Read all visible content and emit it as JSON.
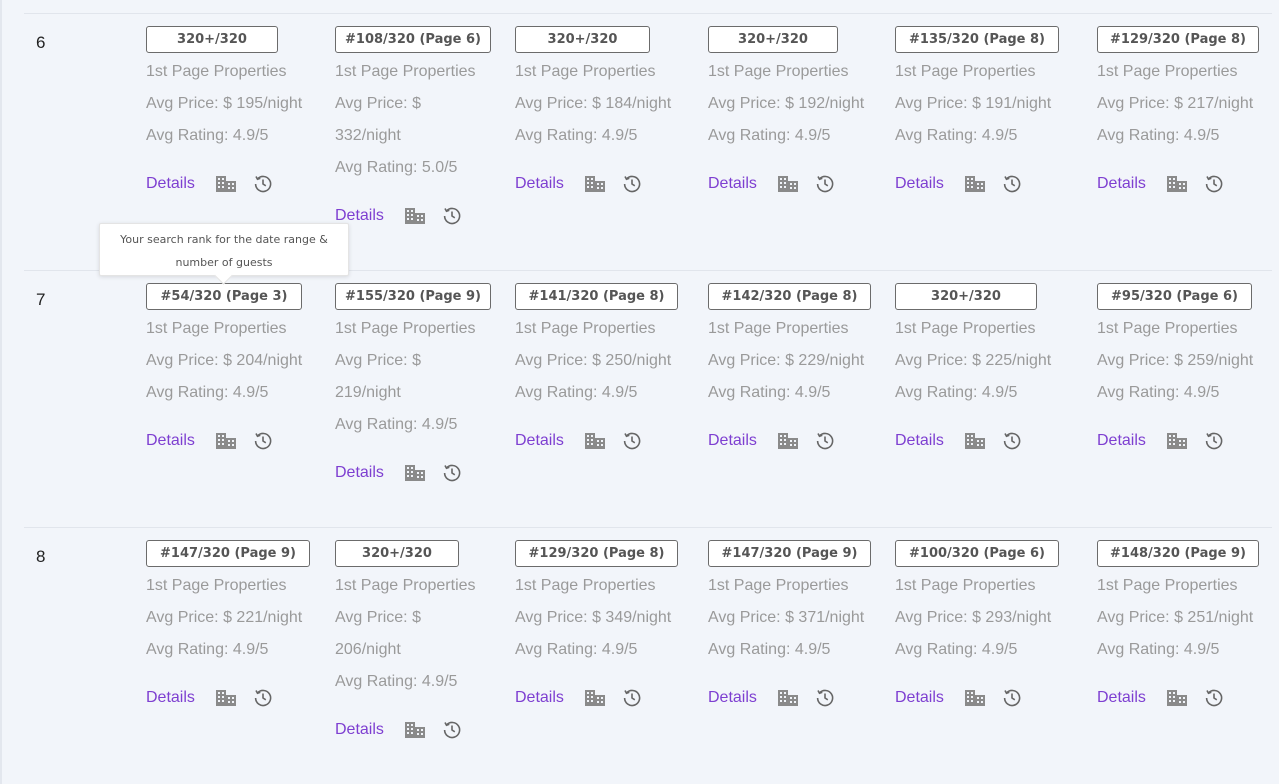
{
  "rows": [
    {
      "label": "6",
      "cells": [
        {
          "rank": "320+/320",
          "line1": "1st Page Properties",
          "price": "Avg Price: $ 195/night",
          "rating": "Avg Rating: 4.9/5",
          "details": "Details"
        },
        {
          "rank": "#108/320 (Page 6)",
          "line1": "1st Page Properties",
          "price": "Avg Price: $ 332/night",
          "rating": "Avg Rating: 5.0/5",
          "details": "Details"
        },
        {
          "rank": "320+/320",
          "line1": "1st Page Properties",
          "price": "Avg Price: $ 184/night",
          "rating": "Avg Rating: 4.9/5",
          "details": "Details"
        },
        {
          "rank": "320+/320",
          "line1": "1st Page Properties",
          "price": "Avg Price: $ 192/night",
          "rating": "Avg Rating: 4.9/5",
          "details": "Details"
        },
        {
          "rank": "#135/320 (Page 8)",
          "line1": "1st Page Properties",
          "price": "Avg Price: $ 191/night",
          "rating": "Avg Rating: 4.9/5",
          "details": "Details"
        },
        {
          "rank": "#129/320 (Page 8)",
          "line1": "1st Page Properties",
          "price": "Avg Price: $ 217/night",
          "rating": "Avg Rating: 4.9/5",
          "details": "Details"
        }
      ]
    },
    {
      "label": "7",
      "cells": [
        {
          "rank": "#54/320 (Page 3)",
          "line1": "1st Page Properties",
          "price": "Avg Price: $ 204/night",
          "rating": "Avg Rating: 4.9/5",
          "details": "Details"
        },
        {
          "rank": "#155/320 (Page 9)",
          "line1": "1st Page Properties",
          "price": "Avg Price: $ 219/night",
          "rating": "Avg Rating: 4.9/5",
          "details": "Details"
        },
        {
          "rank": "#141/320 (Page 8)",
          "line1": "1st Page Properties",
          "price": "Avg Price: $ 250/night",
          "rating": "Avg Rating: 4.9/5",
          "details": "Details"
        },
        {
          "rank": "#142/320 (Page 8)",
          "line1": "1st Page Properties",
          "price": "Avg Price: $ 229/night",
          "rating": "Avg Rating: 4.9/5",
          "details": "Details"
        },
        {
          "rank": "320+/320",
          "line1": "1st Page Properties",
          "price": "Avg Price: $ 225/night",
          "rating": "Avg Rating: 4.9/5",
          "details": "Details"
        },
        {
          "rank": "#95/320 (Page 6)",
          "line1": "1st Page Properties",
          "price": "Avg Price: $ 259/night",
          "rating": "Avg Rating: 4.9/5",
          "details": "Details"
        }
      ]
    },
    {
      "label": "8",
      "cells": [
        {
          "rank": "#147/320 (Page 9)",
          "line1": "1st Page Properties",
          "price": "Avg Price: $ 221/night",
          "rating": "Avg Rating: 4.9/5",
          "details": "Details"
        },
        {
          "rank": "320+/320",
          "line1": "1st Page Properties",
          "price": "Avg Price: $ 206/night",
          "rating": "Avg Rating: 4.9/5",
          "details": "Details"
        },
        {
          "rank": "#129/320 (Page 8)",
          "line1": "1st Page Properties",
          "price": "Avg Price: $ 349/night",
          "rating": "Avg Rating: 4.9/5",
          "details": "Details"
        },
        {
          "rank": "#147/320 (Page 9)",
          "line1": "1st Page Properties",
          "price": "Avg Price: $ 371/night",
          "rating": "Avg Rating: 4.9/5",
          "details": "Details"
        },
        {
          "rank": "#100/320 (Page 6)",
          "line1": "1st Page Properties",
          "price": "Avg Price: $ 293/night",
          "rating": "Avg Rating: 4.9/5",
          "details": "Details"
        },
        {
          "rank": "#148/320 (Page 9)",
          "line1": "1st Page Properties",
          "price": "Avg Price: $ 251/night",
          "rating": "Avg Rating: 4.9/5",
          "details": "Details"
        }
      ]
    }
  ],
  "tooltip": {
    "text": "Your search rank for the date range & number of guests"
  },
  "icons": {
    "building": "building-icon",
    "history": "history-clock-icon"
  },
  "colors": {
    "link": "#7e3fd1",
    "muted_text": "#9a9a9a",
    "badge_border": "#6b6b6b",
    "background": "#f2f5fa"
  }
}
